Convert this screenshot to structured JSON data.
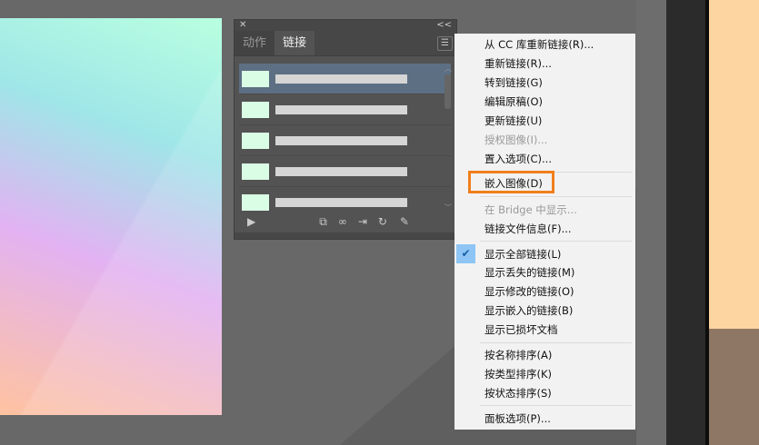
{
  "panel": {
    "close": "✕",
    "collapse": "<<",
    "tabs": [
      {
        "label": "动作"
      },
      {
        "label": "链接"
      }
    ],
    "menu_icon": "☰",
    "bottom_icons": [
      "play",
      "relink-cc",
      "link",
      "goto-link",
      "update",
      "edit"
    ]
  },
  "menu": {
    "items": [
      {
        "label": "从 CC 库重新链接(R)...",
        "disabled": false
      },
      {
        "label": "重新链接(R)...",
        "disabled": false
      },
      {
        "label": "转到链接(G)",
        "disabled": false
      },
      {
        "label": "编辑原稿(O)",
        "disabled": false
      },
      {
        "label": "更新链接(U)",
        "disabled": false
      },
      {
        "label": "授权图像(I)...",
        "disabled": true
      },
      {
        "label": "置入选项(C)...",
        "disabled": false
      },
      {
        "label": "嵌入图像(D)",
        "disabled": false,
        "highlighted": true
      },
      {
        "label": "在 Bridge 中显示...",
        "disabled": true
      },
      {
        "label": "链接文件信息(F)...",
        "disabled": false
      },
      {
        "label": "显示全部链接(L)",
        "checked": true
      },
      {
        "label": "显示丢失的链接(M)"
      },
      {
        "label": "显示修改的链接(O)"
      },
      {
        "label": "显示嵌入的链接(B)"
      },
      {
        "label": "显示已损坏文档"
      },
      {
        "label": "按名称排序(A)"
      },
      {
        "label": "按类型排序(K)"
      },
      {
        "label": "按状态排序(S)"
      },
      {
        "label": "面板选项(P)..."
      }
    ]
  },
  "colors": {
    "highlight": "#f07f1c",
    "check": "#8ec5f4"
  }
}
